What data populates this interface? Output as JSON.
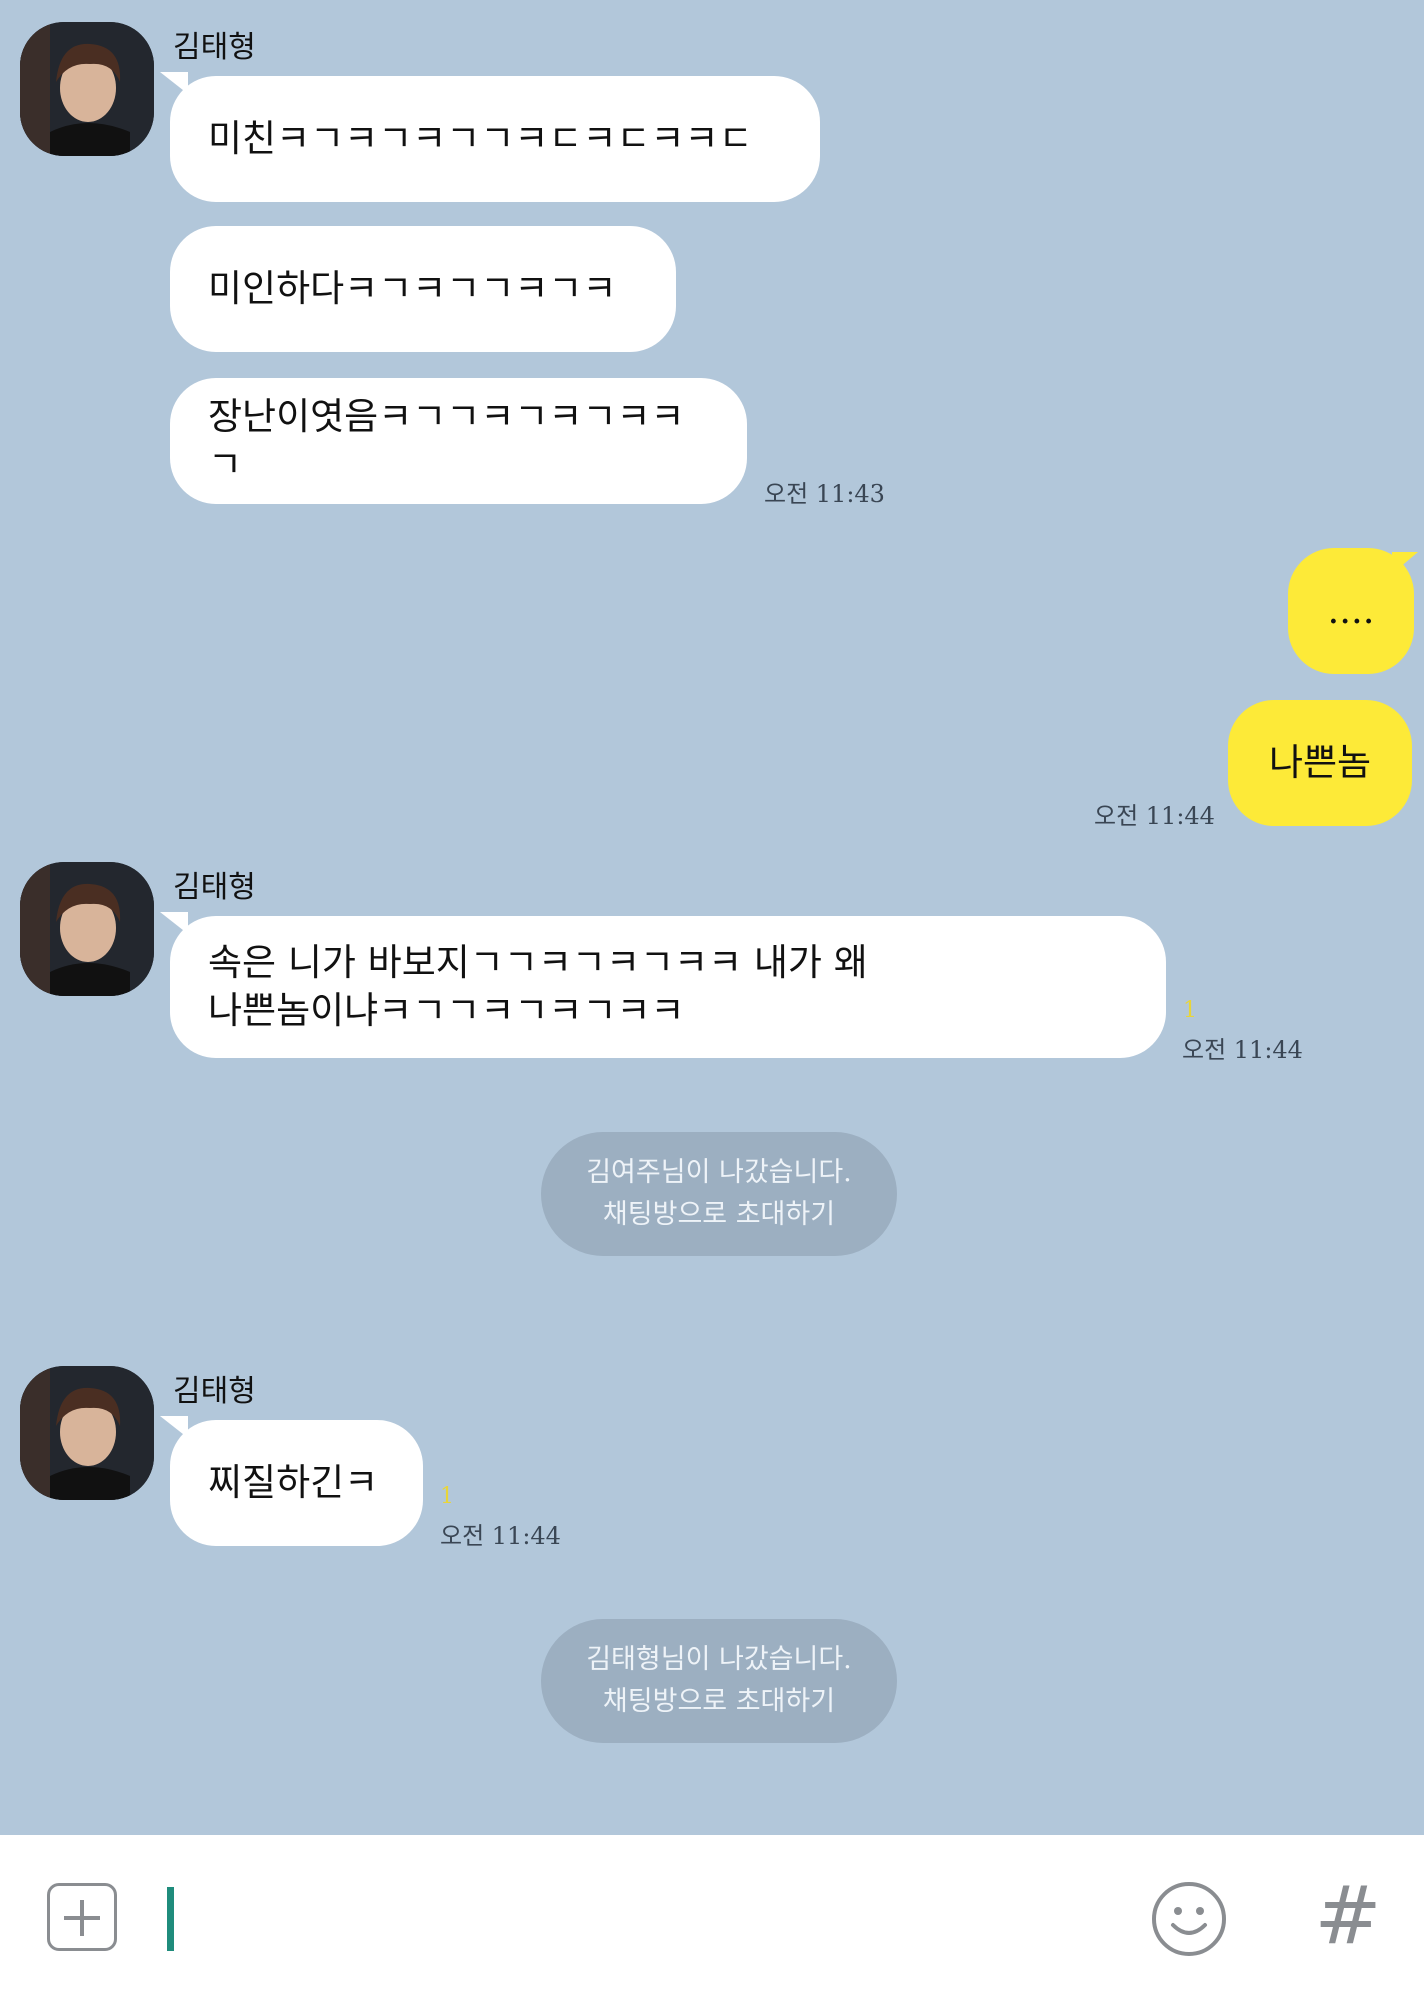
{
  "messages": [
    {
      "sender": "김태형",
      "bubbles": [
        "미친ㅋㄱㅋㄱㅋㄱㄱㅋㄷㅋㄷㅋㅋㄷ",
        "미인하다ㅋㄱㅋㄱㄱㅋㄱㅋ",
        "장난이엿음ㅋㄱㄱㅋㄱㅋㄱㅋㅋㄱ"
      ],
      "time": "오전 11:43"
    },
    {
      "bubbles": [
        "....",
        "나쁜놈"
      ],
      "time": "오전 11:44"
    },
    {
      "sender": "김태형",
      "bubbles": [
        "속은 니가 바보지ㄱㄱㅋㄱㅋㄱㅋㅋ 내가 왜",
        "나쁜놈이냐ㅋㄱㄱㅋㄱㅋㄱㅋㅋ"
      ],
      "unread": "1",
      "time": "오전 11:44"
    },
    {
      "notice": [
        "김여주님이 나갔습니다.",
        "채팅방으로 초대하기"
      ]
    },
    {
      "sender": "김태형",
      "bubbles": [
        "찌질하긴ㅋ"
      ],
      "unread": "1",
      "time": "오전 11:44"
    },
    {
      "notice": [
        "김태형님이 나갔습니다.",
        "채팅방으로 초대하기"
      ]
    }
  ],
  "input": {
    "placeholder": ""
  },
  "icons": {
    "attach": "plus-box-icon",
    "emoticon": "smiley-icon",
    "hashtag": "hash-icon"
  },
  "colors": {
    "background": "#b2c7da",
    "my_bubble": "#fdea38",
    "their_bubble": "#ffffff",
    "cursor": "#1f8c7c",
    "unread": "#e8d53a"
  },
  "hash_symbol": "#"
}
